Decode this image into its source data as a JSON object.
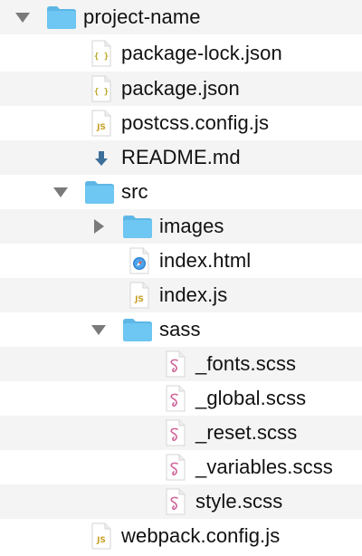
{
  "tree": {
    "root": {
      "name": "project-name",
      "icon": "folder-icon",
      "expanded": true,
      "children_files": [
        {
          "name": "package-lock.json",
          "icon": "json-file-icon"
        },
        {
          "name": "package.json",
          "icon": "json-file-icon"
        },
        {
          "name": "postcss.config.js",
          "icon": "js-file-icon"
        },
        {
          "name": "README.md",
          "icon": "markdown-download-icon"
        }
      ]
    },
    "src": {
      "name": "src",
      "icon": "folder-icon",
      "expanded": true,
      "images": {
        "name": "images",
        "icon": "folder-icon",
        "expanded": false
      },
      "index_html": {
        "name": "index.html",
        "icon": "html-file-icon"
      },
      "index_js": {
        "name": "index.js",
        "icon": "js-file-icon"
      },
      "sass": {
        "name": "sass",
        "icon": "folder-icon",
        "expanded": true,
        "files": [
          {
            "name": "_fonts.scss",
            "icon": "sass-file-icon"
          },
          {
            "name": "_global.scss",
            "icon": "sass-file-icon"
          },
          {
            "name": "_reset.scss",
            "icon": "sass-file-icon"
          },
          {
            "name": "_variables.scss",
            "icon": "sass-file-icon"
          },
          {
            "name": "style.scss",
            "icon": "sass-file-icon"
          }
        ]
      }
    },
    "webpack": {
      "name": "webpack.config.js",
      "icon": "js-file-icon"
    }
  },
  "icon_text": {
    "json_glyph": "{ }",
    "js_glyph": "JS"
  },
  "colors": {
    "folder": "#6ec6f2",
    "folder_tab": "#5db7e6",
    "chevron": "#7a7a7a",
    "row_alt": "#f4f4f4",
    "json_glyph": "#b9a520",
    "js_glyph": "#c9a227",
    "sass_glyph": "#cf649a",
    "markdown_arrow": "#3d6f99",
    "html_compass": "#2f84d6"
  }
}
